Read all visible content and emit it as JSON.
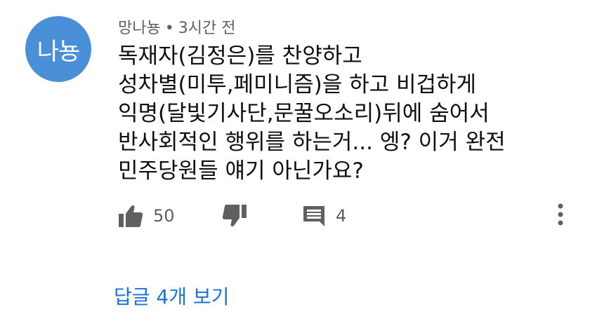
{
  "comment": {
    "avatar_text": "나뇽",
    "author": "망나뇽",
    "separator": "•",
    "time": "3시간 전",
    "lines": [
      "독재자(김정은)를 찬양하고",
      "성차별(미투,페미니즘)을 하고 비겁하게",
      "익명(달빛기사단,문꿀오소리)뒤에 숨어서",
      "반사회적인 행위를 하는거... 엥? 이거 완전",
      "민주당원들 얘기 아닌가요?"
    ]
  },
  "actions": {
    "like_icon": "thumbs-up-icon",
    "like_count": "50",
    "dislike_icon": "thumbs-down-icon",
    "reply_icon": "comment-icon",
    "reply_count": "4",
    "more_icon": "more-vertical-icon"
  },
  "replies": {
    "view_label": "답글 4개 보기"
  },
  "colors": {
    "avatar_bg": "#4a90d9",
    "link": "#1a73d6",
    "secondary_text": "#606060",
    "icon": "#606060"
  }
}
